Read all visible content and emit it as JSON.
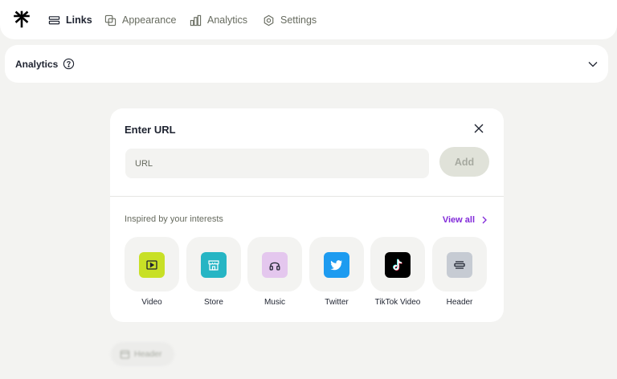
{
  "nav": {
    "items": [
      {
        "label": "Links",
        "icon": "links-icon",
        "active": true
      },
      {
        "label": "Appearance",
        "icon": "appearance-icon",
        "active": false
      },
      {
        "label": "Analytics",
        "icon": "analytics-icon",
        "active": false
      },
      {
        "label": "Settings",
        "icon": "settings-icon",
        "active": false
      }
    ]
  },
  "analytics_bar": {
    "title": "Analytics"
  },
  "modal": {
    "title": "Enter URL",
    "url_placeholder": "URL",
    "add_label": "Add",
    "section_label": "Inspired by your interests",
    "view_all_label": "View all",
    "tiles": [
      {
        "label": "Video",
        "icon": "video-icon",
        "color": "#c8e026"
      },
      {
        "label": "Store",
        "icon": "store-icon",
        "color": "#26b5c4"
      },
      {
        "label": "Music",
        "icon": "music-icon",
        "color": "#e4c7ee"
      },
      {
        "label": "Twitter",
        "icon": "twitter-icon",
        "color": "#1d9bf0"
      },
      {
        "label": "TikTok Video",
        "icon": "tiktok-icon",
        "color": "#000000"
      },
      {
        "label": "Header",
        "icon": "header-icon",
        "color": "#c6cbd3"
      }
    ]
  },
  "ghost_chip": {
    "label": "Header"
  },
  "colors": {
    "accent": "#8129d9",
    "background": "#f3f3f1"
  }
}
